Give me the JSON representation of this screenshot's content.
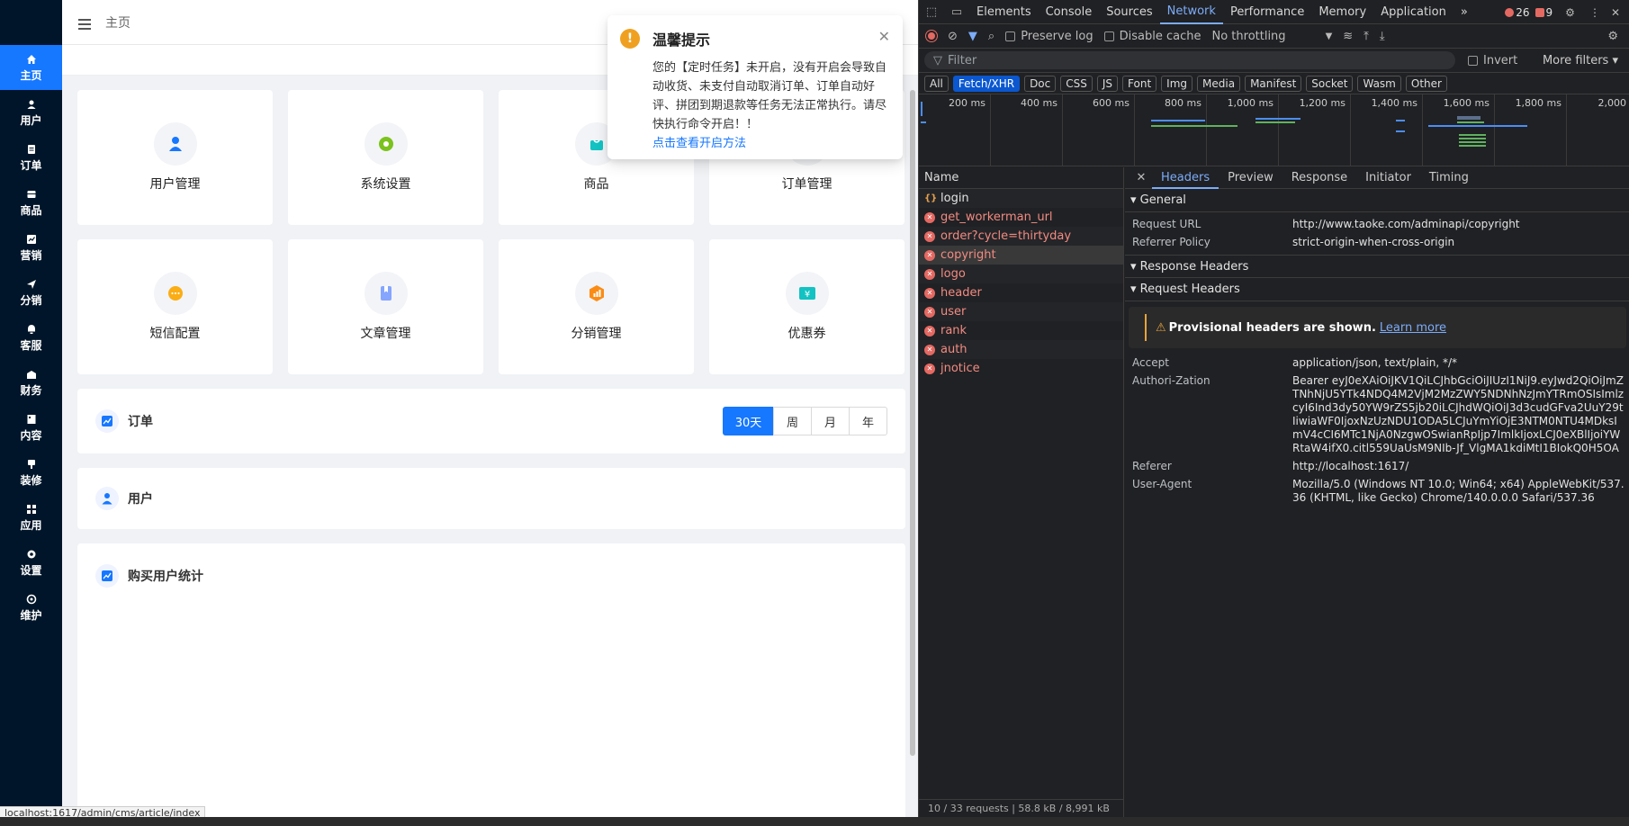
{
  "app": {
    "breadcrumb": "主页",
    "nav": [
      {
        "label": "主页",
        "icon": "home-icon",
        "active": true
      },
      {
        "label": "用户",
        "icon": "user-icon"
      },
      {
        "label": "订单",
        "icon": "order-icon"
      },
      {
        "label": "商品",
        "icon": "goods-icon"
      },
      {
        "label": "营销",
        "icon": "marketing-icon"
      },
      {
        "label": "分销",
        "icon": "send-icon"
      },
      {
        "label": "客服",
        "icon": "bell-icon"
      },
      {
        "label": "财务",
        "icon": "finance-icon"
      },
      {
        "label": "内容",
        "icon": "content-icon"
      },
      {
        "label": "装修",
        "icon": "decor-icon"
      },
      {
        "label": "应用",
        "icon": "apps-icon"
      },
      {
        "label": "设置",
        "icon": "settings-icon"
      },
      {
        "label": "维护",
        "icon": "maintain-icon"
      }
    ],
    "cards": [
      {
        "label": "用户管理",
        "icon": "user-mgmt-icon",
        "color": "#1677ff"
      },
      {
        "label": "系统设置",
        "icon": "gear-icon",
        "color": "#7cc21e"
      },
      {
        "label": "商品",
        "icon": "bag-icon",
        "color": "#13c2c2"
      },
      {
        "label": "订单管理",
        "icon": "order-mgmt-icon",
        "color": "#ff7a45"
      },
      {
        "label": "短信配置",
        "icon": "sms-icon",
        "color": "#faad14"
      },
      {
        "label": "文章管理",
        "icon": "article-icon",
        "color": "#85a5ff"
      },
      {
        "label": "分销管理",
        "icon": "distribution-icon",
        "color": "#fa8c16"
      },
      {
        "label": "优惠券",
        "icon": "coupon-icon",
        "color": "#13c2c2"
      }
    ],
    "order_panel": {
      "title": "订单",
      "ranges": [
        "30天",
        "周",
        "月",
        "年"
      ],
      "selected": "30天"
    },
    "user_panel": {
      "title": "用户"
    },
    "buyers_panel": {
      "title": "购买用户统计"
    },
    "toast": {
      "title": "温馨提示",
      "message": "您的【定时任务】未开启，没有开启会导致自动收货、未支付自动取消订单、订单自动好评、拼团到期退款等任务无法正常执行。请尽快执行命令开启！！",
      "link": "点击查看开启方法"
    },
    "status_url": "localhost:1617/admin/cms/article/index"
  },
  "devtools": {
    "tabs": [
      "Elements",
      "Console",
      "Sources",
      "Network",
      "Performance",
      "Memory",
      "Application"
    ],
    "active_tab": "Network",
    "error_count": "26",
    "warning_count": "9",
    "toolbar": {
      "preserve_log": "Preserve log",
      "disable_cache": "Disable cache",
      "throttling": "No throttling"
    },
    "filter": {
      "placeholder": "Filter",
      "invert": "Invert",
      "more_filters": "More filters"
    },
    "types": [
      "All",
      "Fetch/XHR",
      "Doc",
      "CSS",
      "JS",
      "Font",
      "Img",
      "Media",
      "Manifest",
      "Socket",
      "Wasm",
      "Other"
    ],
    "active_type": "Fetch/XHR",
    "timeline_labels": [
      "200 ms",
      "400 ms",
      "600 ms",
      "800 ms",
      "1,000 ms",
      "1,200 ms",
      "1,400 ms",
      "1,600 ms",
      "1,800 ms",
      "2,000"
    ],
    "name_header": "Name",
    "requests": [
      {
        "name": "login",
        "status": "pending"
      },
      {
        "name": "get_workerman_url",
        "status": "error"
      },
      {
        "name": "order?cycle=thirtyday",
        "status": "error"
      },
      {
        "name": "copyright",
        "status": "error",
        "selected": true
      },
      {
        "name": "logo",
        "status": "error"
      },
      {
        "name": "header",
        "status": "error"
      },
      {
        "name": "user",
        "status": "error"
      },
      {
        "name": "rank",
        "status": "error"
      },
      {
        "name": "auth",
        "status": "error"
      },
      {
        "name": "jnotice",
        "status": "error"
      }
    ],
    "footer": "10 / 33 requests  |  58.8 kB / 8,991 kB",
    "detail_tabs": [
      "Headers",
      "Preview",
      "Response",
      "Initiator",
      "Timing"
    ],
    "active_detail_tab": "Headers",
    "general": {
      "title": "General",
      "request_url_label": "Request URL",
      "request_url": "http://www.taoke.com/adminapi/copyright",
      "referrer_policy_label": "Referrer Policy",
      "referrer_policy": "strict-origin-when-cross-origin"
    },
    "response_headers_title": "Response Headers",
    "request_headers": {
      "title": "Request Headers",
      "provisional": "Provisional headers are shown.",
      "learn_more": "Learn more",
      "accept_label": "Accept",
      "accept": "application/json, text/plain, */*",
      "auth_label": "Authori-Zation",
      "auth": "Bearer eyJ0eXAiOiJKV1QiLCJhbGciOiJIUzI1NiJ9.eyJwd2QiOiJmZTNhNjU5YTk4NDQ4M2VjM2MzZWY5NDNhNzJmYTRmOSIsImlzcyI6Ind3dy50YW9rZS5jb20iLCJhdWQiOiJ3d3cudGFva2UuY29tIiwiaWF0IjoxNzUzNDU1ODA5LCJuYmYiOjE3NTM0NTU4MDksImV4cCI6MTc1NjA0NzgwOSwianRpIjp7ImlkIjoxLCJ0eXBlIjoiYWRtaW4ifX0.citl559UaUsM9NIb-Jf_VlgMA1kdiMtI1BIokQ0H5OA",
      "referer_label": "Referer",
      "referer": "http://localhost:1617/",
      "ua_label": "User-Agent",
      "ua": "Mozilla/5.0 (Windows NT 10.0; Win64; x64) AppleWebKit/537.36 (KHTML, like Gecko) Chrome/140.0.0.0 Safari/537.36"
    }
  }
}
